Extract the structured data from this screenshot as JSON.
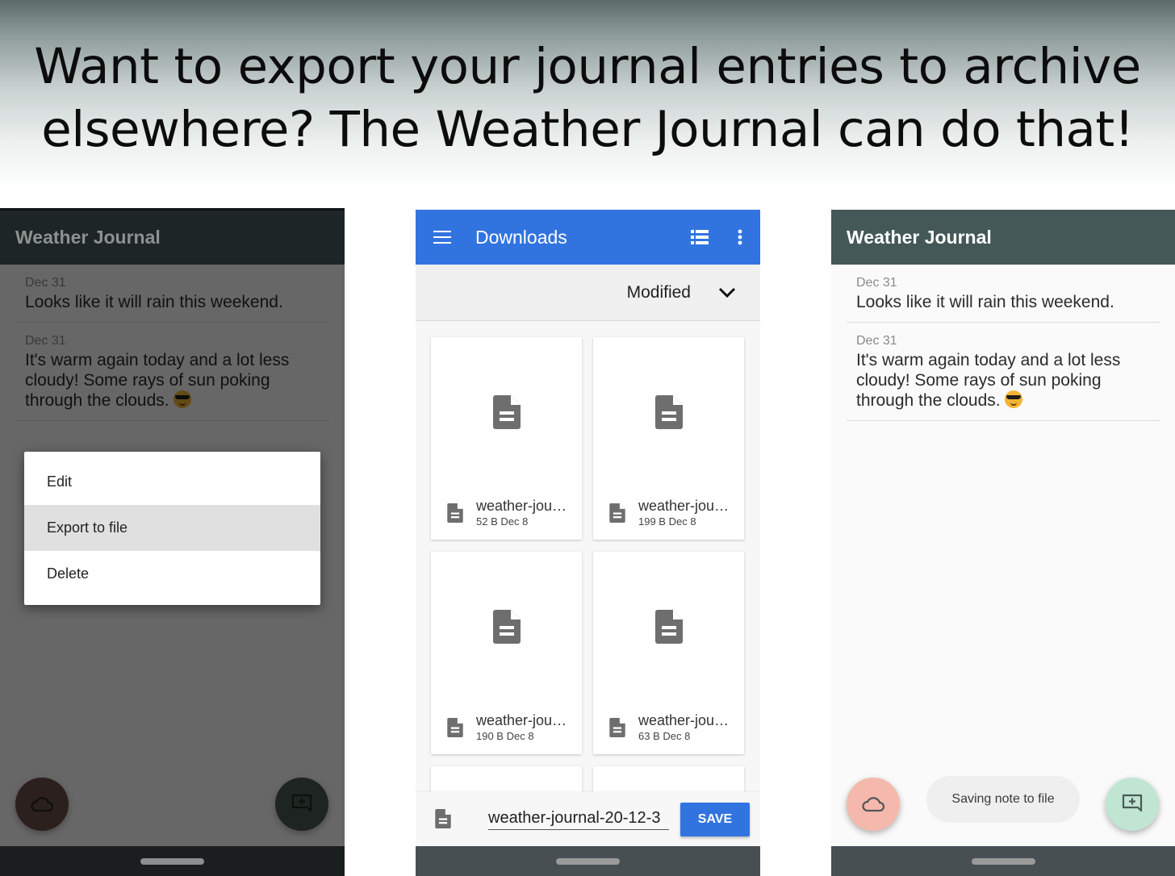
{
  "headline": {
    "line1": "Want to export your journal entries to archive",
    "line2": "elsewhere? The Weather Journal can do that!"
  },
  "colors": {
    "journal_appbar": "#445957",
    "downloads_appbar": "#3174e0",
    "weather_fab": "#f4b8ad",
    "add_fab": "#c0e5d3"
  },
  "left_screen": {
    "app_title": "Weather Journal",
    "entries": [
      {
        "date": "Dec 31",
        "text": "Looks like it will rain this weekend."
      },
      {
        "date": "Dec 31",
        "text": "It's warm again today and a lot less cloudy! Some rays of sun poking through the clouds.",
        "emoji": "smiling-face-with-sunglasses"
      }
    ],
    "context_menu": {
      "items": [
        {
          "label": "Edit",
          "highlighted": false
        },
        {
          "label": "Export to file",
          "highlighted": true
        },
        {
          "label": "Delete",
          "highlighted": false
        }
      ]
    },
    "fabs": {
      "left_icon": "cloud-icon",
      "right_icon": "add-comment-icon"
    }
  },
  "middle_screen": {
    "app_title": "Downloads",
    "menu_icon": "hamburger-icon",
    "view_icon": "list-view-icon",
    "overflow_icon": "more-vert-icon",
    "sort": {
      "label": "Modified",
      "icon": "chevron-down-icon"
    },
    "files": [
      {
        "name": "weather-jou…",
        "size": "52 B",
        "date": "Dec 8"
      },
      {
        "name": "weather-jou…",
        "size": "199 B",
        "date": "Dec 8"
      },
      {
        "name": "weather-jou…",
        "size": "190 B",
        "date": "Dec 8"
      },
      {
        "name": "weather-jou…",
        "size": "63 B",
        "date": "Dec 8"
      }
    ],
    "save_bar": {
      "filename": "weather-journal-20-12-3",
      "save_label": "SAVE"
    }
  },
  "right_screen": {
    "app_title": "Weather Journal",
    "entries": [
      {
        "date": "Dec 31",
        "text": "Looks like it will rain this weekend."
      },
      {
        "date": "Dec 31",
        "text": "It's warm again today and a lot less cloudy! Some rays of sun poking through the clouds.",
        "emoji": "smiling-face-with-sunglasses"
      }
    ],
    "snackbar": "Saving note to file",
    "fabs": {
      "left_icon": "cloud-icon",
      "right_icon": "add-comment-icon"
    }
  }
}
